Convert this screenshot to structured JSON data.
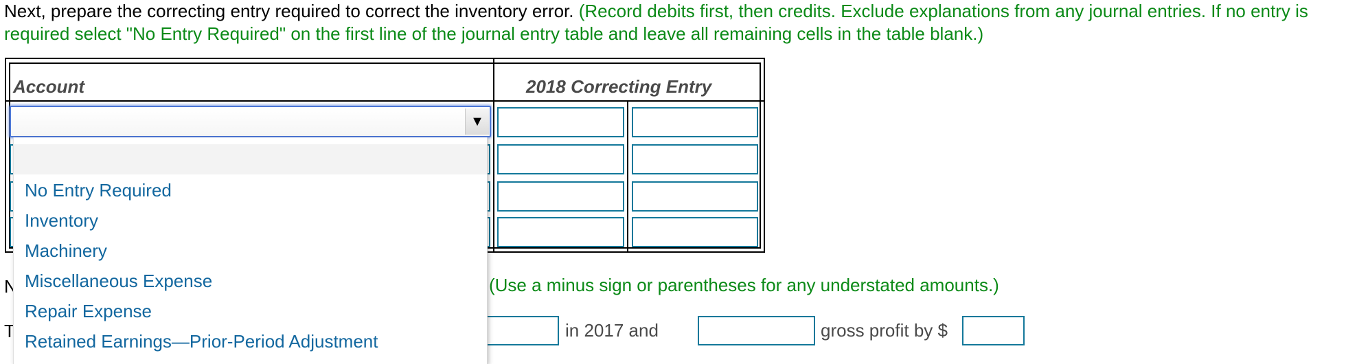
{
  "instructions": {
    "lead": "Next, prepare the correcting entry required to correct the inventory error.",
    "note": "(Record debits first, then credits. Exclude explanations from any journal entries. If no entry is required select \"No Entry Required\" on the first line of the journal entry table and leave all remaining cells in the table blank.)"
  },
  "journal": {
    "account_header": "Account",
    "entry_header": "2018 Correcting Entry",
    "rows": [
      {
        "account": "",
        "debit": "",
        "credit": ""
      },
      {
        "account": "",
        "debit": "",
        "credit": ""
      },
      {
        "account": "",
        "debit": "",
        "credit": ""
      },
      {
        "account": "",
        "debit": "",
        "credit": ""
      }
    ],
    "selected_account": "",
    "dropdown_arrow": "▼",
    "dropdown_options": [
      "",
      "No Entry Required",
      "Inventory",
      "Machinery",
      "Miscellaneous Expense",
      "Repair Expense",
      "Retained Earnings—Prior-Period Adjustment"
    ]
  },
  "partial": {
    "hidden_line1_start": "N",
    "hidden_line2_start": "T",
    "note": "(Use a minus sign or parentheses for any understated amounts.)",
    "text_in_2017_and": "in 2017 and",
    "text_gross_profit_by": "gross profit by $",
    "input1_value": "",
    "input2_value": "",
    "input3_value": ""
  },
  "colors": {
    "instruction_green": "#0b8a17",
    "input_border": "#13789a",
    "option_text": "#12679f",
    "select_focus": "#4c77d6"
  }
}
